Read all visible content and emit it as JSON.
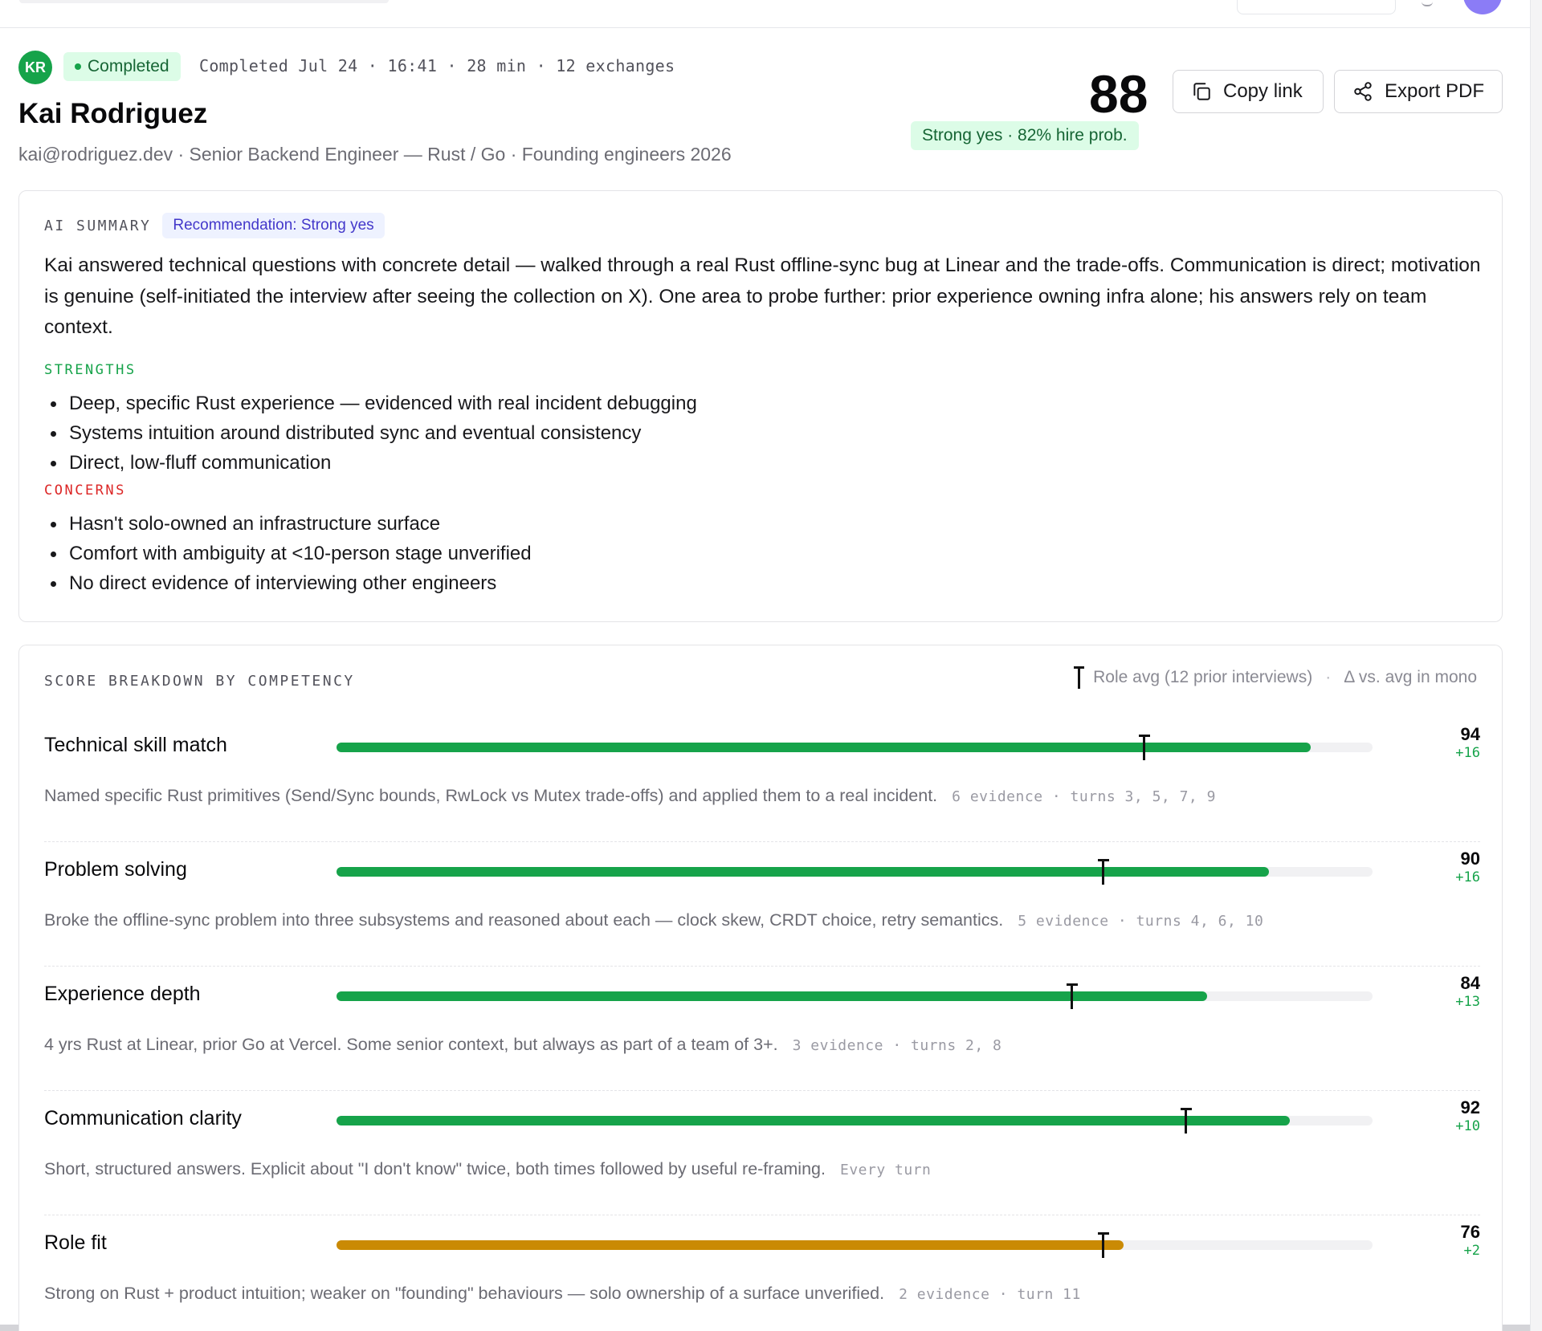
{
  "candidate": {
    "initials": "KR",
    "status": "Completed",
    "meta": "Completed Jul 24 · 16:41 · 28 min · 12 exchanges",
    "name": "Kai Rodriguez",
    "subtitle": "kai@rodriguez.dev · Senior Backend Engineer — Rust / Go · Founding engineers 2026"
  },
  "score": {
    "value": "88",
    "verdict": "Strong yes · 82% hire prob."
  },
  "actions": {
    "copy_label": "Copy link",
    "export_label": "Export PDF"
  },
  "summary": {
    "label": "AI SUMMARY",
    "recommendation": "Recommendation: Strong yes",
    "text": "Kai answered technical questions with concrete detail — walked through a real Rust offline-sync bug at Linear and the trade-offs. Communication is direct; motivation is genuine (self-initiated the interview after seeing the collection on X). One area to probe further: prior experience owning infra alone; his answers rely on team context.",
    "strengths_label": "STRENGTHS",
    "strengths": [
      "Deep, specific Rust experience — evidenced with real incident debugging",
      "Systems intuition around distributed sync and eventual consistency",
      "Direct, low-fluff communication"
    ],
    "concerns_label": "CONCERNS",
    "concerns": [
      "Hasn't solo-owned an infrastructure surface",
      "Comfort with ambiguity at <10-person stage unverified",
      "No direct evidence of interviewing other engineers"
    ]
  },
  "breakdown": {
    "label": "SCORE BREAKDOWN BY COMPETENCY",
    "legend_avg": "Role avg (12 prior interviews)",
    "legend_sep": "·",
    "legend_delta": "Δ vs. avg in mono",
    "accent_green": "#16a34a",
    "accent_amber": "#ca8a04",
    "rows": [
      {
        "name": "Technical skill match",
        "score": 94,
        "score_label": "94",
        "avg": 78,
        "delta": "+16",
        "color": "green",
        "desc": "Named specific Rust primitives (Send/Sync bounds, RwLock vs Mutex trade-offs) and applied them to a real incident.",
        "evidence": "6 evidence · turns 3, 5, 7, 9"
      },
      {
        "name": "Problem solving",
        "score": 90,
        "score_label": "90",
        "avg": 74,
        "delta": "+16",
        "color": "green",
        "desc": "Broke the offline-sync problem into three subsystems and reasoned about each — clock skew, CRDT choice, retry semantics.",
        "evidence": "5 evidence · turns 4, 6, 10"
      },
      {
        "name": "Experience depth",
        "score": 84,
        "score_label": "84",
        "avg": 71,
        "delta": "+13",
        "color": "green",
        "desc": "4 yrs Rust at Linear, prior Go at Vercel. Some senior context, but always as part of a team of 3+.",
        "evidence": "3 evidence · turns 2, 8"
      },
      {
        "name": "Communication clarity",
        "score": 92,
        "score_label": "92",
        "avg": 82,
        "delta": "+10",
        "color": "green",
        "desc": "Short, structured answers. Explicit about \"I don't know\" twice, both times followed by useful re-framing.",
        "evidence": "Every turn"
      },
      {
        "name": "Role fit",
        "score": 76,
        "score_label": "76",
        "avg": 74,
        "delta": "+2",
        "color": "amber",
        "desc": "Strong on Rust + product intuition; weaker on \"founding\" behaviours — solo ownership of a surface unverified.",
        "evidence": "2 evidence · turn 11"
      }
    ]
  }
}
